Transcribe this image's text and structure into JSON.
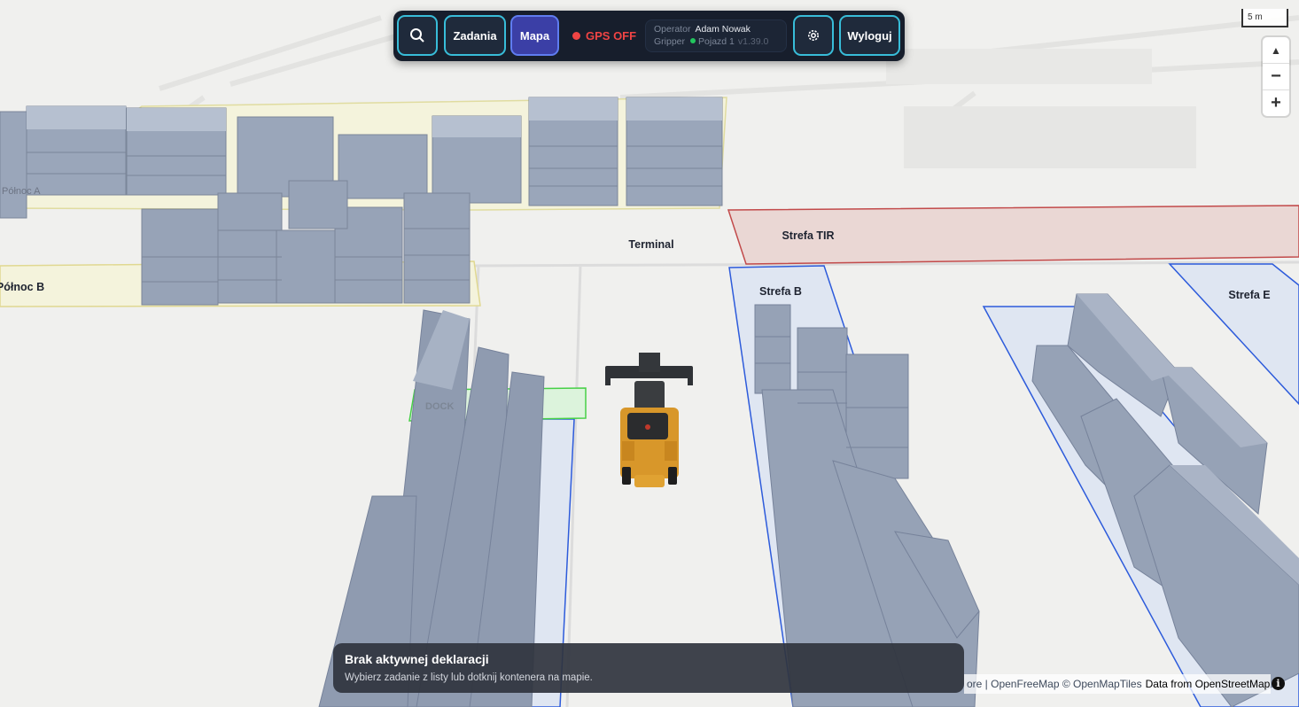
{
  "toolbar": {
    "search_icon": "search-icon",
    "tasks_label": "Zadania",
    "map_label": "Mapa",
    "gps_status": "GPS OFF",
    "operator_label": "Operator",
    "operator_name": "Adam Nowak",
    "role_label": "Gripper",
    "vehicle": "Pojazd 1",
    "version": "v1.39.0",
    "settings_icon": "gear-icon",
    "logout_label": "Wyloguj"
  },
  "map": {
    "scale_label": "5 m",
    "zones": {
      "terminal": "Terminal",
      "strefa_tir": "Strefa TIR",
      "strefa_b": "Strefa B",
      "strefa_e": "Strefa E",
      "polnoc_b": "Północ B",
      "polnoc_a": "Północ A",
      "dock": "DOCK"
    },
    "controls": {
      "compass": "▲",
      "zoom_out": "−",
      "zoom_in": "+"
    }
  },
  "notice": {
    "title": "Brak aktywnej deklaracji",
    "subtitle": "Wybierz zadanie z listy lub dotknij kontenera na mapie."
  },
  "attribution": {
    "text": "ore | OpenFreeMap © OpenMapTiles",
    "source": "Data from OpenStreetMap",
    "info_icon": "info-icon"
  },
  "colors": {
    "accent": "#38bdd9",
    "active": "#3b3fa6",
    "gps_off": "#ef4444",
    "online": "#22c55e",
    "container": "#9aa6ba"
  }
}
